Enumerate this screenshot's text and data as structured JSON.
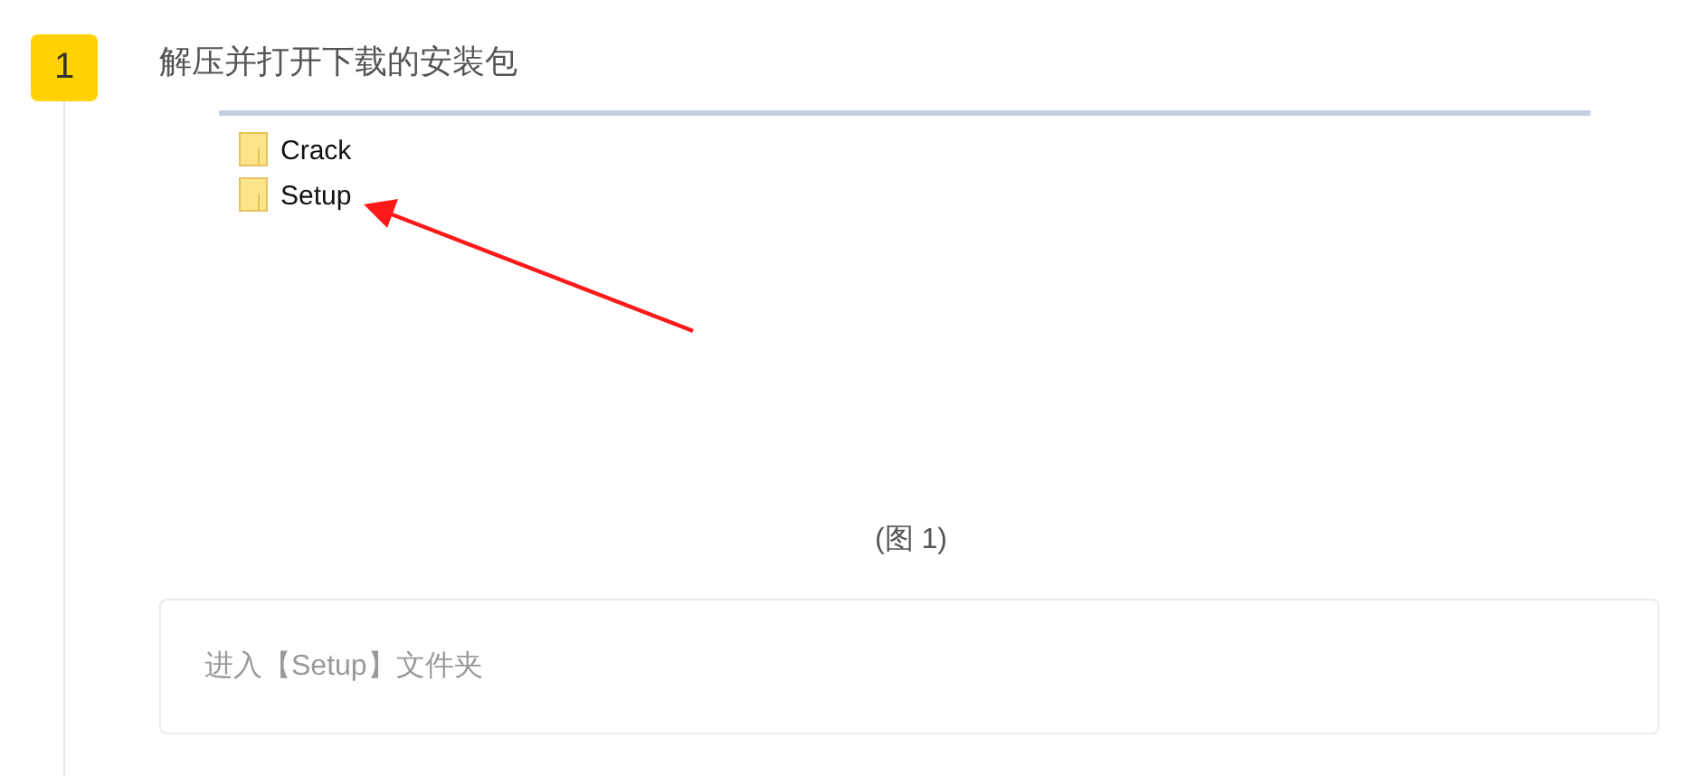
{
  "step": {
    "number": "1",
    "title": "解压并打开下载的安装包"
  },
  "screenshot": {
    "folders": [
      {
        "name": "Crack"
      },
      {
        "name": "Setup"
      }
    ]
  },
  "caption": "(图 1)",
  "note": "进入【Setup】文件夹"
}
